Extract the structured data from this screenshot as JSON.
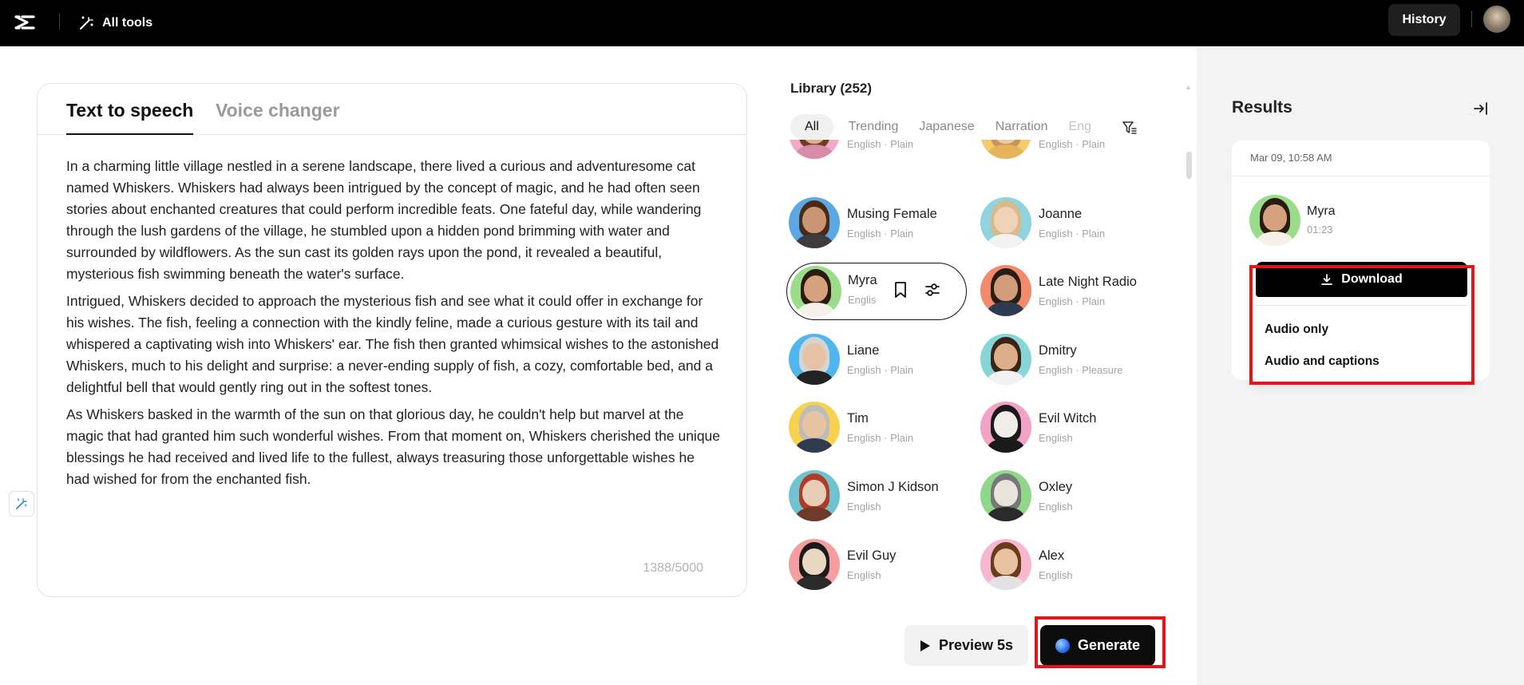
{
  "topbar": {
    "all_tools_label": "All tools",
    "history_label": "History"
  },
  "editor": {
    "tabs": [
      {
        "label": "Text to speech",
        "active": true
      },
      {
        "label": "Voice changer",
        "active": false
      }
    ],
    "paragraphs": [
      "In a charming little village nestled in a serene landscape, there lived a curious and adventuresome cat named Whiskers. Whiskers had always been intrigued by the concept of magic, and he had often seen stories about enchanted creatures that could perform incredible feats. One fateful day, while wandering through the lush gardens of the village, he stumbled upon a hidden pond brimming with water and surrounded by wildflowers. As the sun cast its golden rays upon the pond, it revealed a beautiful, mysterious fish swimming beneath the water's surface.",
      "Intrigued, Whiskers decided to approach the mysterious fish and see what it could offer in exchange for his wishes. The fish, feeling a connection with the kindly feline, made a curious gesture with its tail and whispered a captivating wish into Whiskers' ear. The fish then granted whimsical wishes to the astonished Whiskers, much to his delight and surprise: a never-ending supply of fish, a cozy, comfortable bed, and a delightful bell that would gently ring out in the softest tones.",
      "As Whiskers basked in the warmth of the sun on that glorious day, he couldn't help but marvel at the magic that had granted him such wonderful wishes. From that moment on, Whiskers cherished the unique blessings he had received and lived life to the fullest, always treasuring those unforgettable wishes he had wished for from the enchanted fish."
    ],
    "char_count": "1388/5000"
  },
  "library": {
    "title": "Library (252)",
    "filters": [
      "All",
      "Trending",
      "Japanese",
      "Narration",
      "Eng"
    ],
    "active_filter": "All",
    "voices": [
      {
        "name": "",
        "sub": "English · Plain"
      },
      {
        "name": "",
        "sub": "English · Plain"
      },
      {
        "name": "Musing Female",
        "sub": "English · Plain"
      },
      {
        "name": "Joanne",
        "sub": "English · Plain"
      },
      {
        "name": "Myra",
        "sub": "Englis"
      },
      {
        "name": "Late Night Radio",
        "sub": "English · Plain"
      },
      {
        "name": "Liane",
        "sub": "English · Plain"
      },
      {
        "name": "Dmitry",
        "sub": "English · Pleasure"
      },
      {
        "name": "Tim",
        "sub": "English · Plain"
      },
      {
        "name": "Evil Witch",
        "sub": "English"
      },
      {
        "name": "Simon J Kidson",
        "sub": "English"
      },
      {
        "name": "Oxley",
        "sub": "English"
      },
      {
        "name": "Evil Guy",
        "sub": "English"
      },
      {
        "name": "Alex",
        "sub": "English"
      }
    ],
    "selected_voice": "Myra"
  },
  "actions": {
    "preview_label": "Preview 5s",
    "generate_label": "Generate"
  },
  "results": {
    "title": "Results",
    "card": {
      "date": "Mar 09, 10:58 AM",
      "name": "Myra",
      "duration": "01:23"
    },
    "download_menu": {
      "download_label": "Download",
      "items": [
        "Audio only",
        "Audio and captions"
      ]
    }
  },
  "colors": {
    "highlight_outline": "#e0161b",
    "topbar_bg": "#000000",
    "results_bg": "#f3f3f3"
  }
}
